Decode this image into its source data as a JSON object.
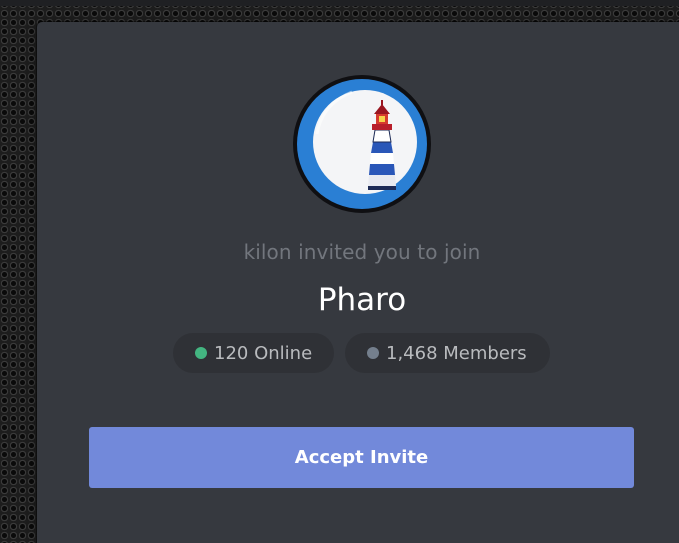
{
  "invite": {
    "inviter_text": "kilon invited you to join",
    "server_name": "Pharo",
    "server_icon": "lighthouse-icon",
    "online_count": "120 Online",
    "member_count": "1,468 Members",
    "accept_label": "Accept Invite"
  },
  "colors": {
    "modal_background": "#36393f",
    "stat_pill_background": "#2f3136",
    "online_dot": "#43b581",
    "members_dot": "#747f8d",
    "accept_button": "#7289da",
    "server_icon_ring": "#2a7fd4"
  }
}
